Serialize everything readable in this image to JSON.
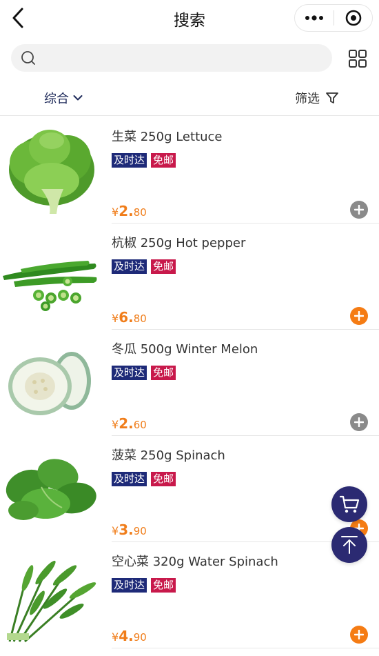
{
  "nav": {
    "title": "搜索"
  },
  "search": {
    "placeholder": "",
    "value": ""
  },
  "filters": {
    "sort_label": "综合",
    "filter_label": "筛选"
  },
  "tags": {
    "fast": "及时达",
    "free": "免邮"
  },
  "products": [
    {
      "name": "生菜 250g Lettuce",
      "currency": "¥",
      "price_int": "2.",
      "price_dec": "80",
      "add_state": "grey",
      "image": "lettuce"
    },
    {
      "name": "杭椒 250g Hot pepper",
      "currency": "¥",
      "price_int": "6.",
      "price_dec": "80",
      "add_state": "orange",
      "image": "hot-pepper"
    },
    {
      "name": "冬瓜 500g Winter Melon",
      "currency": "¥",
      "price_int": "2.",
      "price_dec": "60",
      "add_state": "grey",
      "image": "winter-melon"
    },
    {
      "name": "菠菜 250g Spinach",
      "currency": "¥",
      "price_int": "3.",
      "price_dec": "90",
      "add_state": "orange",
      "image": "spinach"
    },
    {
      "name": "空心菜 320g Water Spinach",
      "currency": "¥",
      "price_int": "4.",
      "price_dec": "90",
      "add_state": "orange",
      "image": "water-spinach"
    }
  ],
  "colors": {
    "accent": "#f57c14",
    "navy": "#2b2a72",
    "tag_fast": "#1e2a78",
    "tag_free": "#c8194b",
    "price": "#f07d1a"
  }
}
